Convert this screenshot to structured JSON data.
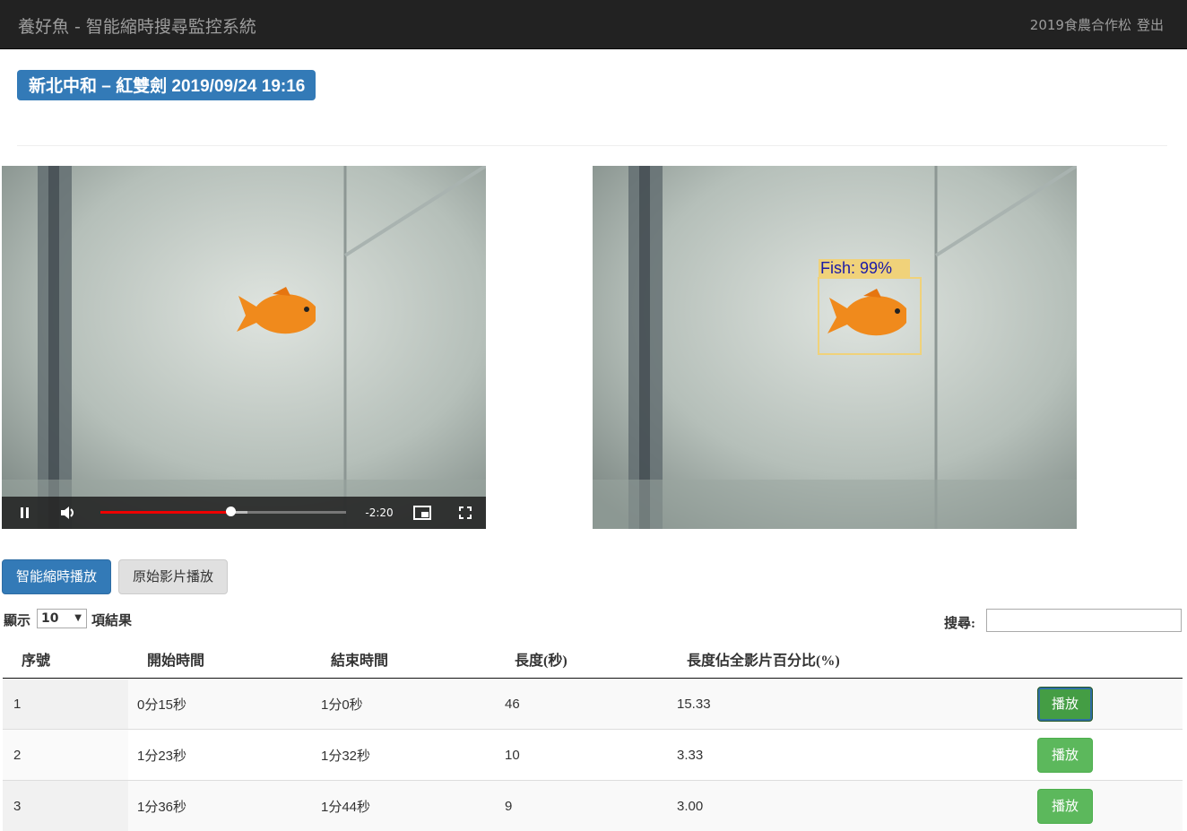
{
  "navbar": {
    "brand": "養好魚 - 智能縮時搜尋監控系統",
    "user": "2019食農合作松",
    "logout": "登出"
  },
  "title": "新北中和 – 紅雙劍 2019/09/24 19:16",
  "player": {
    "time_remaining": "-2:20",
    "progress_fraction": 0.53
  },
  "detection": {
    "label": "Fish: 99%"
  },
  "buttons": {
    "smart_play": "智能縮時播放",
    "original_play": "原始影片播放"
  },
  "table_controls": {
    "show": "顯示",
    "page_length": "10",
    "results": "項結果",
    "search_label": "搜尋:",
    "search_value": ""
  },
  "table": {
    "headers": [
      "序號",
      "開始時間",
      "結束時間",
      "長度(秒)",
      "長度佔全影片百分比(%)",
      ""
    ],
    "rows": [
      {
        "no": "1",
        "start": "0分15秒",
        "end": "1分0秒",
        "length": "46",
        "percent": "15.33",
        "action": "播放"
      },
      {
        "no": "2",
        "start": "1分23秒",
        "end": "1分32秒",
        "length": "10",
        "percent": "3.33",
        "action": "播放"
      },
      {
        "no": "3",
        "start": "1分36秒",
        "end": "1分44秒",
        "length": "9",
        "percent": "3.00",
        "action": "播放"
      }
    ]
  },
  "colors": {
    "primary": "#337ab7",
    "success": "#5cb85c",
    "navbar": "#222222"
  }
}
